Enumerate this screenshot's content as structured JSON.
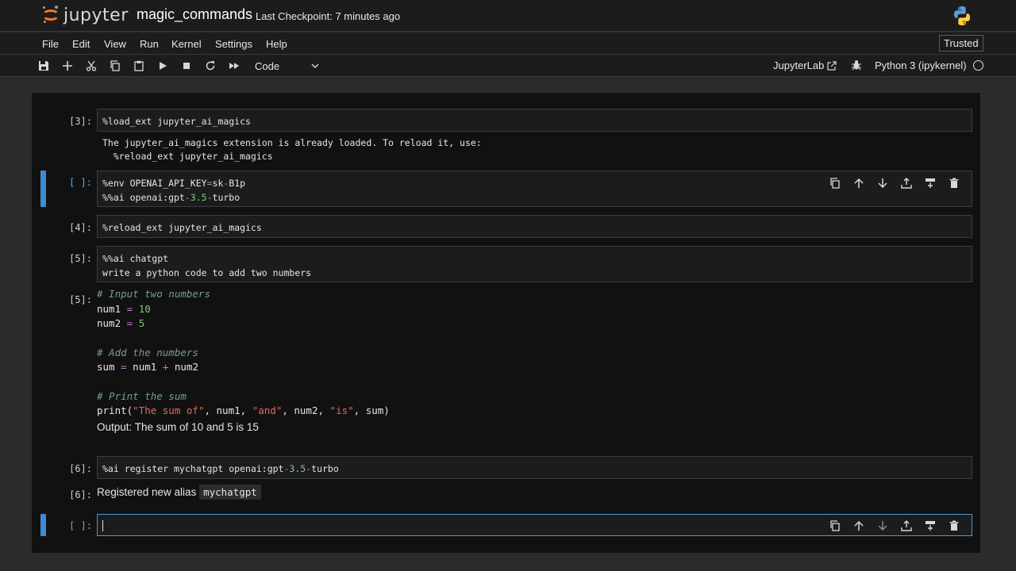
{
  "header": {
    "logo_text": "jupyter",
    "notebook_title": "magic_commands",
    "checkpoint": "Last Checkpoint: 7 minutes ago"
  },
  "menu": [
    "File",
    "Edit",
    "View",
    "Run",
    "Kernel",
    "Settings",
    "Help"
  ],
  "trusted_label": "Trusted",
  "toolbar": {
    "cell_type": "Code",
    "jupyterlab_label": "JupyterLab",
    "kernel_name": "Python 3 (ipykernel)"
  },
  "cells": {
    "c1": {
      "prompt": "[3]:",
      "source": "%load_ext jupyter_ai_magics",
      "output_line1": "The jupyter_ai_magics extension is already loaded. To reload it, use:",
      "output_line2": "  %reload_ext jupyter_ai_magics"
    },
    "c2": {
      "prompt": "[ ]:",
      "line1_a": "%env OPENAI_API_KEY",
      "line1_b": "=",
      "line1_c": "sk",
      "line1_d": "-",
      "line1_e": "B1p",
      "line2_a": "%%ai openai:gpt",
      "line2_b": "-",
      "line2_c": "3.5",
      "line2_d": "-",
      "line2_e": "turbo"
    },
    "c3": {
      "prompt": "[4]:",
      "source": "%reload_ext jupyter_ai_magics"
    },
    "c4": {
      "prompt": "[5]:",
      "line1": "%%ai chatgpt",
      "line2": "write a python code to add two numbers"
    },
    "c4_out": {
      "prompt": "[5]:",
      "comment1": "# Input two numbers",
      "num1_var": "num1",
      "num1_val": "10",
      "num2_var": "num2",
      "num2_val": "5",
      "comment2": "# Add the numbers",
      "sum_var": "sum",
      "sum_a": "num1",
      "sum_op": "+",
      "sum_b": "num2",
      "comment3": "# Print the sum",
      "print_fn": "print(",
      "s1": "\"The sum of\"",
      "a1": ", num1, ",
      "s2": "\"and\"",
      "a2": ", num2, ",
      "s3": "\"is\"",
      "a3": ", sum)",
      "output": "Output: The sum of 10 and 5 is 15"
    },
    "c5": {
      "prompt": "[6]:",
      "a": "%ai register mychatgpt openai:gpt",
      "b": "-",
      "c": "3.5",
      "d": "-",
      "e": "turbo"
    },
    "c5_out": {
      "prompt": "[6]:",
      "text": "Registered new alias ",
      "alias": "mychatgpt"
    },
    "c6": {
      "prompt": "[ ]:",
      "source": ""
    }
  },
  "icons": {
    "toolbar": [
      "save-icon",
      "add-icon",
      "cut-icon",
      "copy-icon",
      "paste-icon",
      "run-icon",
      "stop-icon",
      "restart-icon",
      "run-all-icon"
    ],
    "cell": [
      "duplicate-icon",
      "move-up-icon",
      "move-down-icon",
      "insert-above-icon",
      "insert-below-icon",
      "delete-icon"
    ]
  },
  "colors": {
    "accent": "#3f8bd1",
    "logo_orange": "#f37726",
    "comment": "#7a9a9a",
    "number": "#7fc97f",
    "string": "#e06c5a",
    "operator": "#c678dd"
  }
}
